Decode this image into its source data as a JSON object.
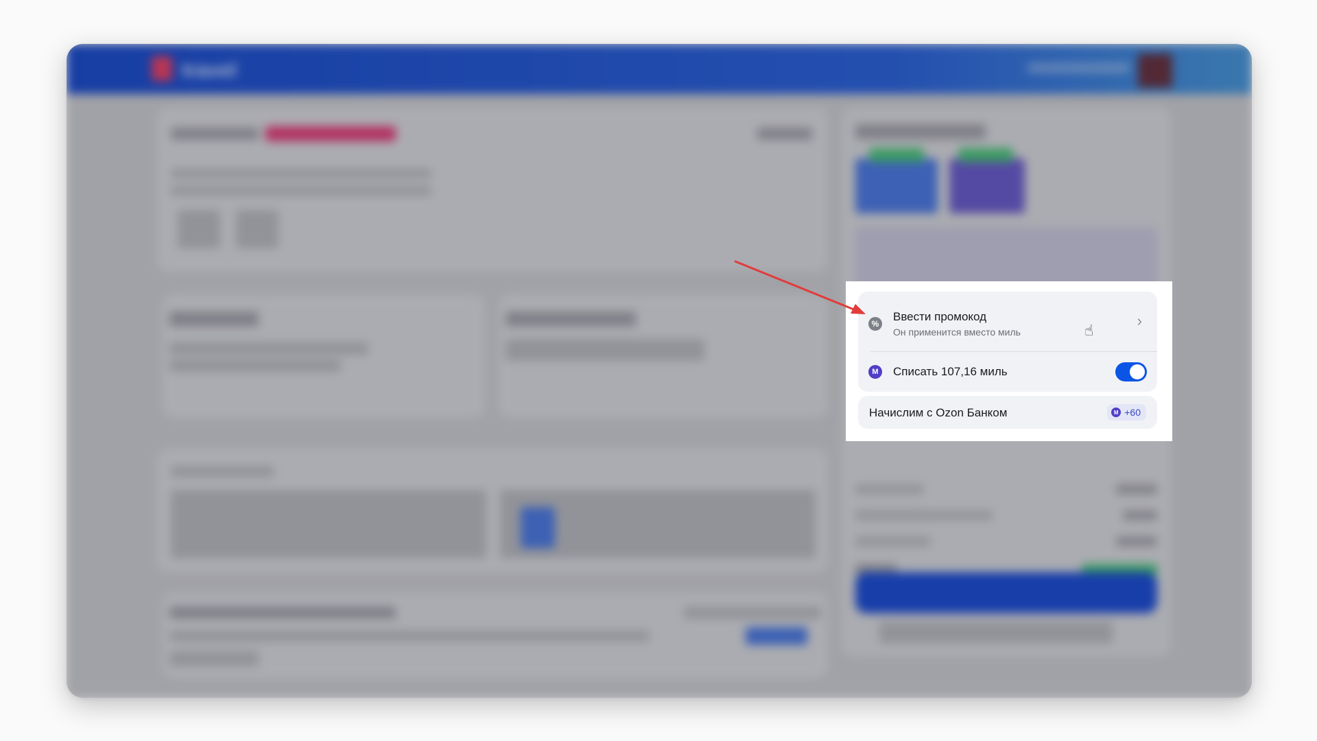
{
  "header": {
    "logo_text": "travel"
  },
  "promo": {
    "title": "Ввести промокод",
    "subtitle": "Он применится вместо миль",
    "icon": "percent-icon"
  },
  "miles": {
    "label": "Списать 107,16 миль",
    "icon": "miles-icon",
    "toggle_on": true
  },
  "bank": {
    "label": "Начислим с Ozon Банком",
    "badge_text": "+60",
    "badge_icon": "miles-icon"
  },
  "colors": {
    "header_blue": "#1b57d9",
    "toggle_blue": "#0b55e6",
    "miles_purple": "#4f3ec7",
    "arrow_red": "#e23b3b"
  }
}
